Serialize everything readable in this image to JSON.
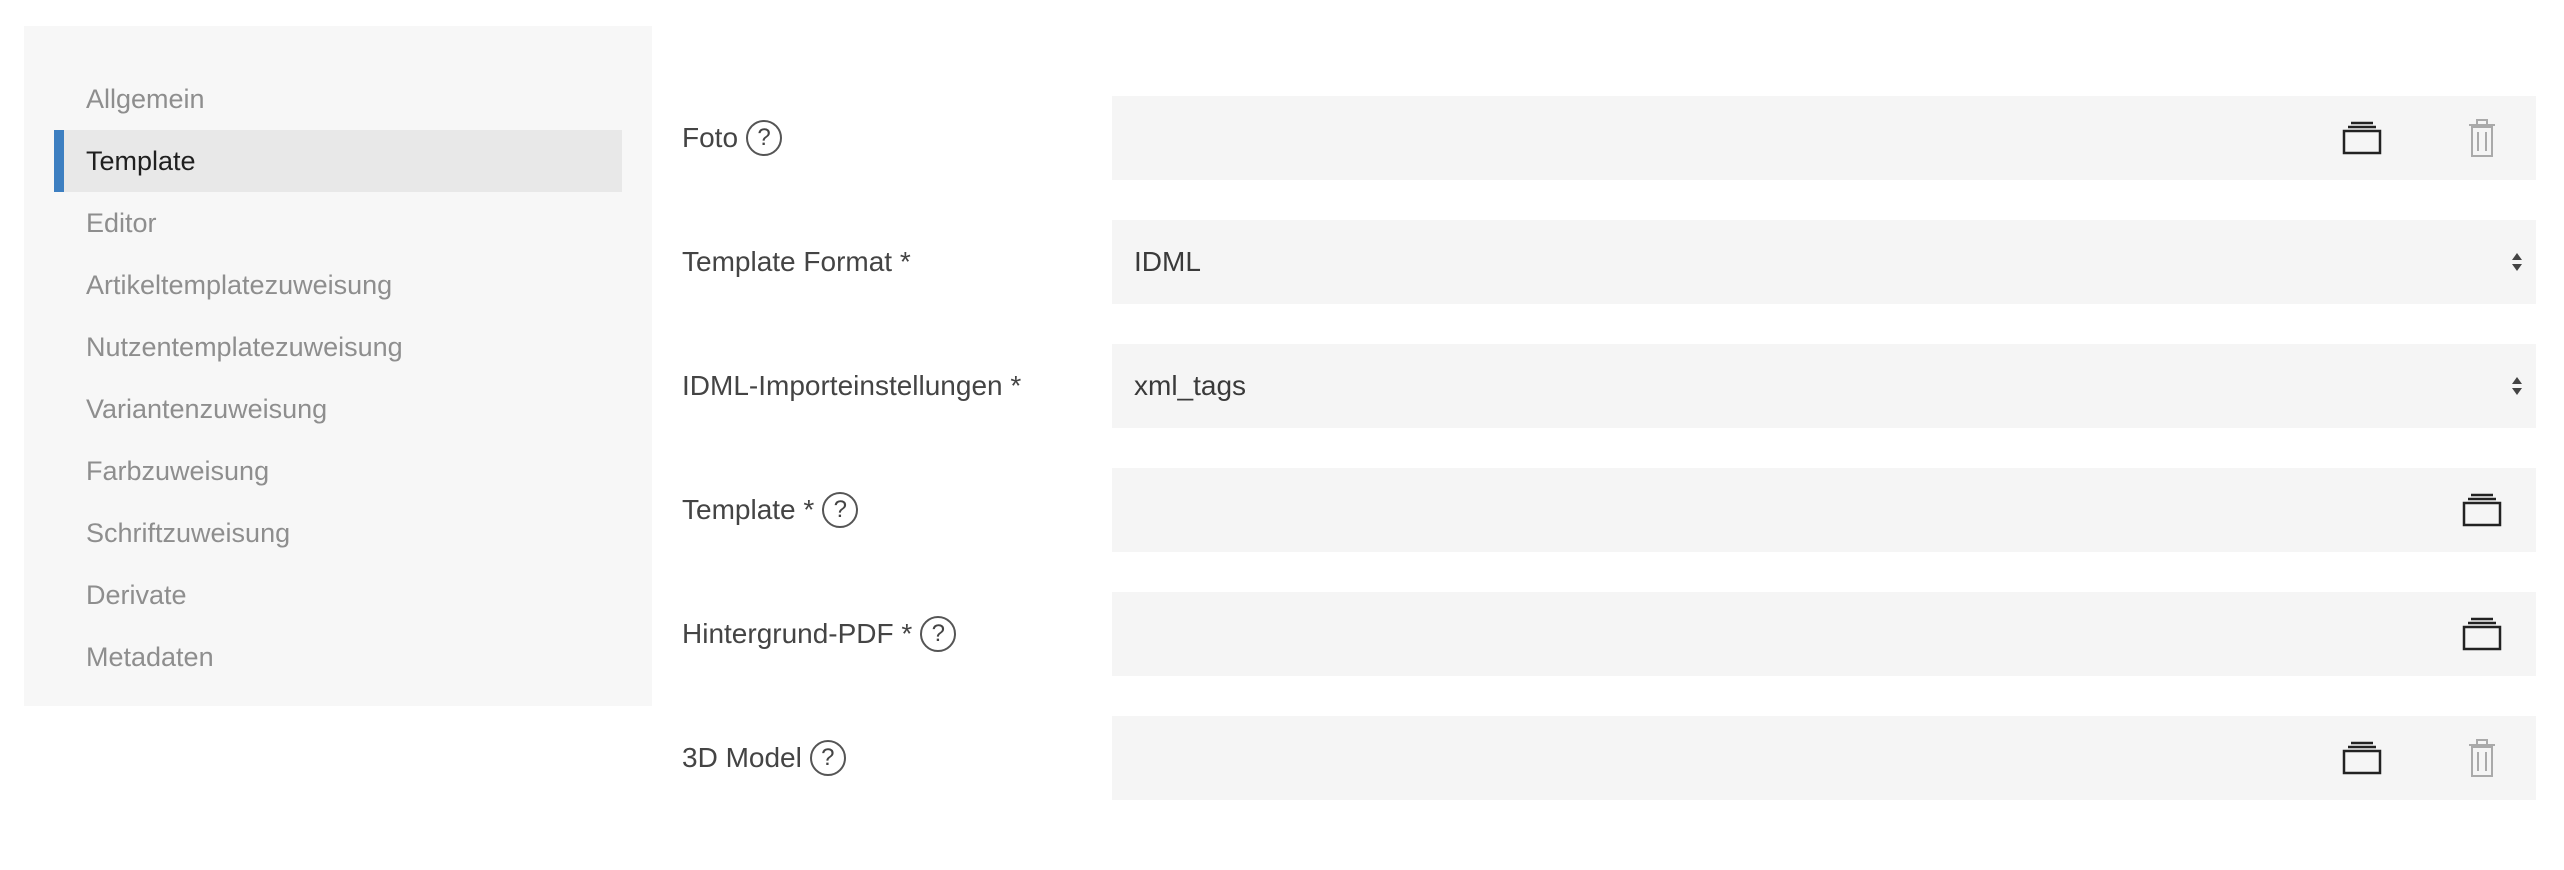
{
  "sidebar": {
    "items": [
      {
        "label": "Allgemein",
        "active": false
      },
      {
        "label": "Template",
        "active": true
      },
      {
        "label": "Editor",
        "active": false
      },
      {
        "label": "Artikeltemplatezuweisung",
        "active": false
      },
      {
        "label": "Nutzentemplatezuweisung",
        "active": false
      },
      {
        "label": "Variantenzuweisung",
        "active": false
      },
      {
        "label": "Farbzuweisung",
        "active": false
      },
      {
        "label": "Schriftzuweisung",
        "active": false
      },
      {
        "label": "Derivate",
        "active": false
      },
      {
        "label": "Metadaten",
        "active": false
      }
    ],
    "accent_color": "#3d7fc1"
  },
  "form": {
    "fields": [
      {
        "label": "Foto",
        "help": "?",
        "type": "file",
        "icons": [
          "folder-icon",
          "trash-icon"
        ]
      },
      {
        "label": "Template Format *",
        "type": "select",
        "value": "IDML",
        "icons": [
          "select-arrows-icon"
        ]
      },
      {
        "label": "IDML-Importeinstellungen *",
        "type": "select",
        "value": "xml_tags",
        "icons": [
          "select-arrows-icon"
        ]
      },
      {
        "label": "Template *",
        "help": "?",
        "type": "file",
        "icons": [
          "folder-icon"
        ]
      },
      {
        "label": "Hintergrund-PDF *",
        "help": "?",
        "type": "file",
        "icons": [
          "folder-icon"
        ]
      },
      {
        "label": "3D Model",
        "help": "?",
        "type": "file",
        "icons": [
          "folder-icon",
          "trash-icon"
        ]
      }
    ]
  }
}
